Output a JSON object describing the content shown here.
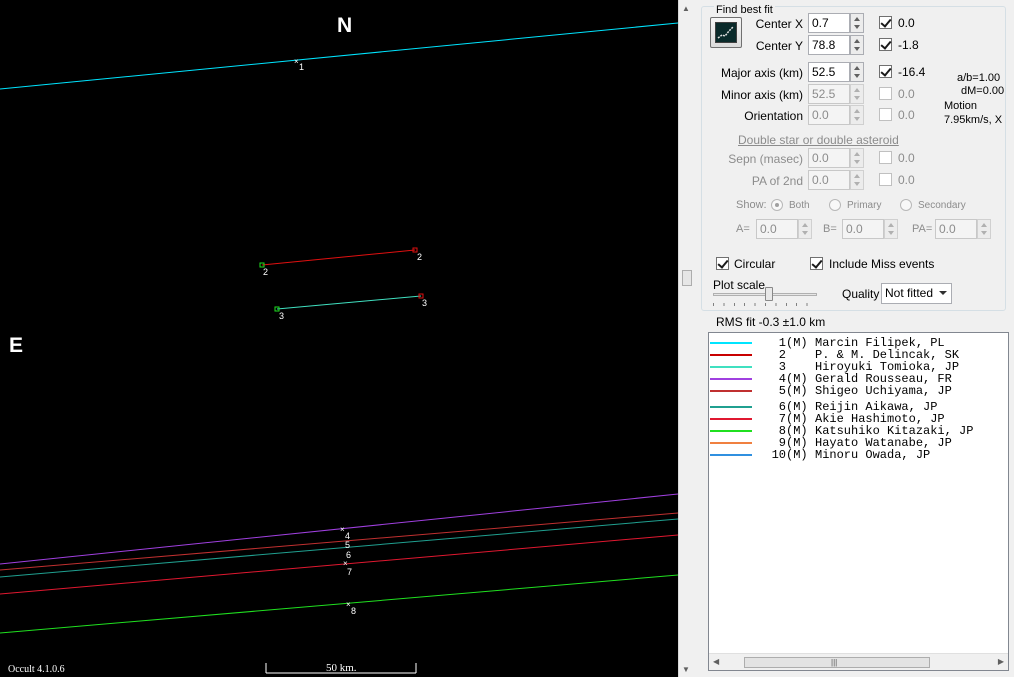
{
  "plot": {
    "compass_n": "N",
    "compass_e": "E",
    "version": "Occult 4.1.0.6",
    "scale_label": "50 km.",
    "chord_labels": [
      "1",
      "2",
      "2",
      "3",
      "3",
      "4",
      "5",
      "6",
      "7",
      "8"
    ]
  },
  "panel": {
    "group_title": "Find best fit",
    "center_x": {
      "label": "Center X",
      "value": "0.7",
      "fix_value": "0.0",
      "fixed": true
    },
    "center_y": {
      "label": "Center Y",
      "value": "78.8",
      "fix_value": "-1.8",
      "fixed": true
    },
    "major": {
      "label": "Major axis (km)",
      "value": "52.5",
      "fix_value": "-16.4",
      "fixed": true
    },
    "minor": {
      "label": "Minor axis (km)",
      "value": "52.5",
      "fix_value": "0.0",
      "fixed": false
    },
    "orientation": {
      "label": "Orientation",
      "value": "0.0",
      "fix_value": "0.0",
      "fixed": false
    },
    "ratio_text": "a/b=1.00",
    "dm_text": "dM=0.00",
    "motion_label": "Motion",
    "motion_value": "7.95km/s, X",
    "double_star_link": "Double star  or  double asteroid",
    "sepn": {
      "label": "Sepn (masec)",
      "value": "0.0",
      "fix_value": "0.0"
    },
    "pa2": {
      "label": "PA of 2nd",
      "value": "0.0",
      "fix_value": "0.0"
    },
    "show_label": "Show:",
    "radio_both": "Both",
    "radio_primary": "Primary",
    "radio_secondary": "Secondary",
    "a_label": "A=",
    "a_value": "0.0",
    "b_label": "B=",
    "b_value": "0.0",
    "pa_label": "PA=",
    "pa_value": "0.0",
    "circular_label": "Circular",
    "include_miss_label": "Include Miss events",
    "plot_scale_label": "Plot scale",
    "quality_label": "Quality",
    "quality_value": "Not fitted",
    "rms_text": "RMS fit -0.3 ±1.0 km"
  },
  "observers": [
    {
      "num": "1",
      "mark": "(M)",
      "name": "Marcin Filipek, PL",
      "color": "#00e5ff"
    },
    {
      "num": "2",
      "mark": "",
      "name": "P. & M. Delincak, SK",
      "color": "#c80000"
    },
    {
      "num": "3",
      "mark": "",
      "name": "Hiroyuki Tomioka, JP",
      "color": "#40e0c0"
    },
    {
      "num": "4",
      "mark": "(M)",
      "name": "Gerald Rousseau, FR",
      "color": "#a040e0"
    },
    {
      "num": "5",
      "mark": "(M)",
      "name": "Shigeo Uchiyama, JP",
      "color": "#c03030"
    },
    {
      "num": "6",
      "mark": "(M)",
      "name": "Reijin Aikawa, JP",
      "color": "#20a090"
    },
    {
      "num": "7",
      "mark": "(M)",
      "name": "Akie Hashimoto, JP",
      "color": "#e01830"
    },
    {
      "num": "8",
      "mark": "(M)",
      "name": "Katsuhiko Kitazaki, JP",
      "color": "#20e020"
    },
    {
      "num": "9",
      "mark": "(M)",
      "name": "Hayato Watanabe, JP",
      "color": "#f08040"
    },
    {
      "num": "10",
      "mark": "(M)",
      "name": "Minoru Owada, JP",
      "color": "#3090e0"
    }
  ]
}
